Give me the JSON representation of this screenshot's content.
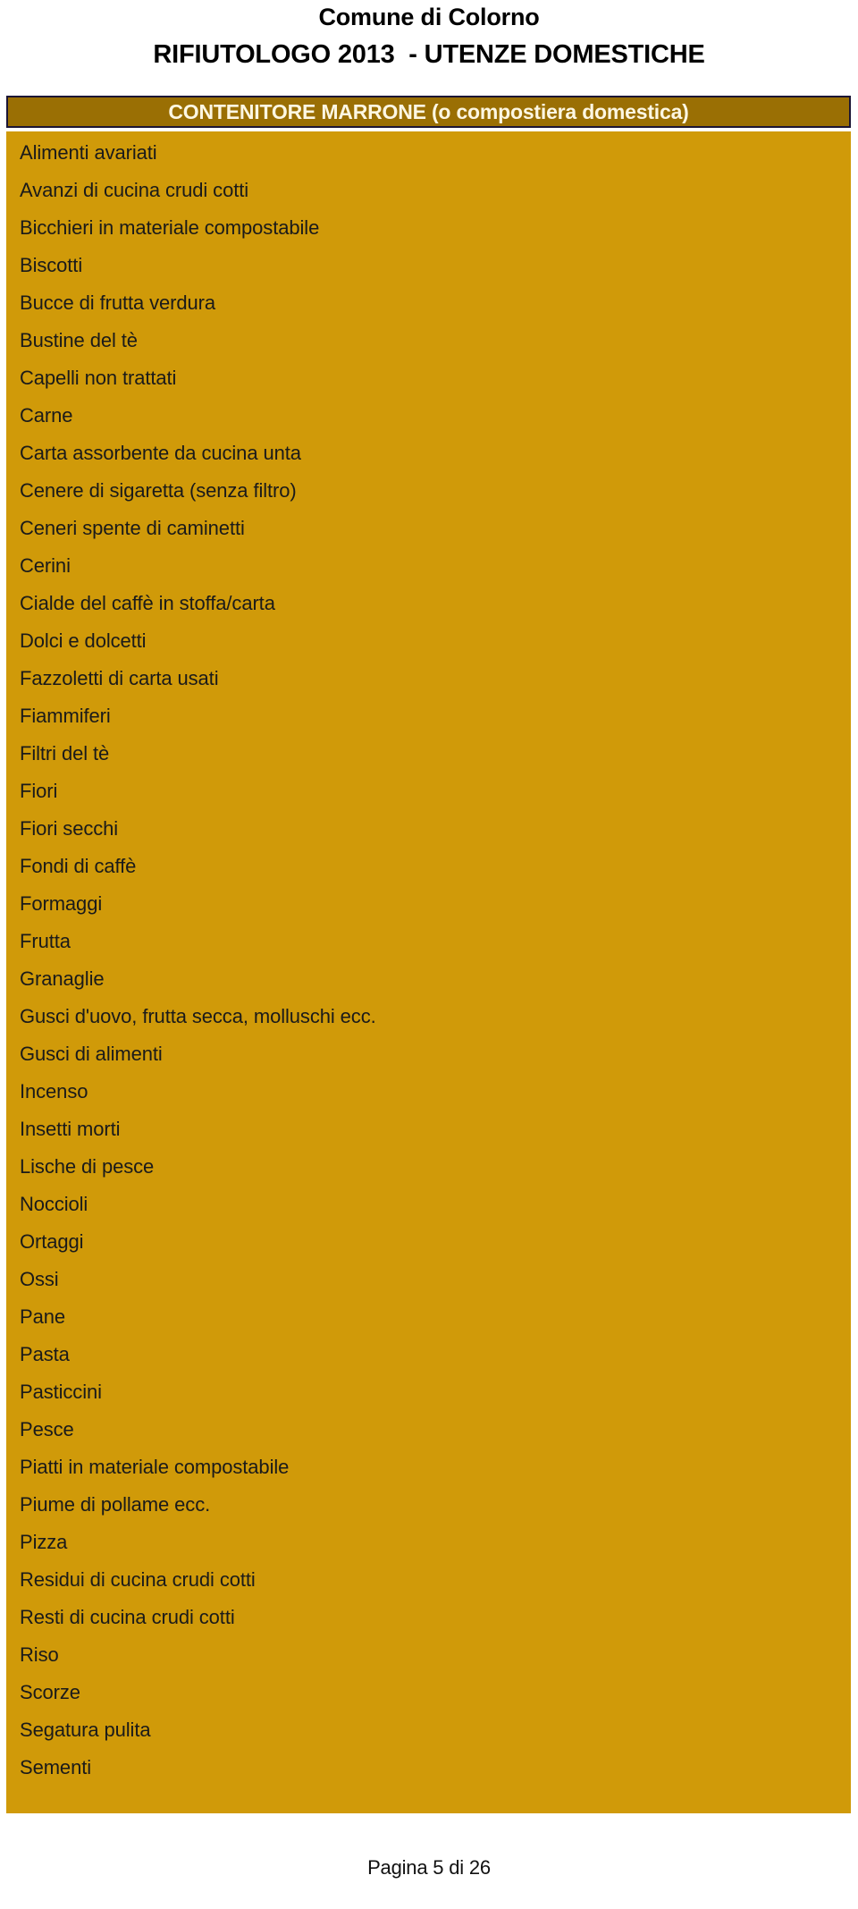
{
  "header": {
    "municipality": "Comune di Colorno",
    "document_title": "RIFIUTOLOGO 2013  - UTENZE DOMESTICHE"
  },
  "container": {
    "label": "CONTENITORE MARRONE (o compostiera domestica)",
    "bar_fill_color": "#9a6f04",
    "bar_border_color": "#1b1535",
    "bar_text_color": "#fdf7e3",
    "panel_color": "#d09a09",
    "item_text_color": "#1a1a1a"
  },
  "waste_items": [
    "Alimenti avariati",
    "Avanzi di cucina crudi cotti",
    "Bicchieri in materiale compostabile",
    "Biscotti",
    "Bucce di frutta verdura",
    "Bustine del tè",
    "Capelli non trattati",
    "Carne",
    "Carta assorbente da cucina unta",
    "Cenere di sigaretta (senza filtro)",
    "Ceneri spente di caminetti",
    "Cerini",
    "Cialde del caffè in stoffa/carta",
    "Dolci e dolcetti",
    "Fazzoletti di carta usati",
    "Fiammiferi",
    "Filtri del tè",
    "Fiori",
    "Fiori secchi",
    "Fondi di caffè",
    "Formaggi",
    "Frutta",
    "Granaglie",
    "Gusci d'uovo, frutta secca, molluschi ecc.",
    "Gusci di alimenti",
    "Incenso",
    "Insetti morti",
    "Lische di pesce",
    "Noccioli",
    "Ortaggi",
    "Ossi",
    "Pane",
    "Pasta",
    "Pasticcini",
    "Pesce",
    "Piatti in materiale compostabile",
    "Piume di pollame ecc.",
    "Pizza",
    "Residui di cucina crudi cotti",
    "Resti di cucina crudi cotti",
    "Riso",
    "Scorze",
    "Segatura pulita",
    "Sementi"
  ],
  "footer": {
    "page_label": "Pagina 5 di 26"
  }
}
